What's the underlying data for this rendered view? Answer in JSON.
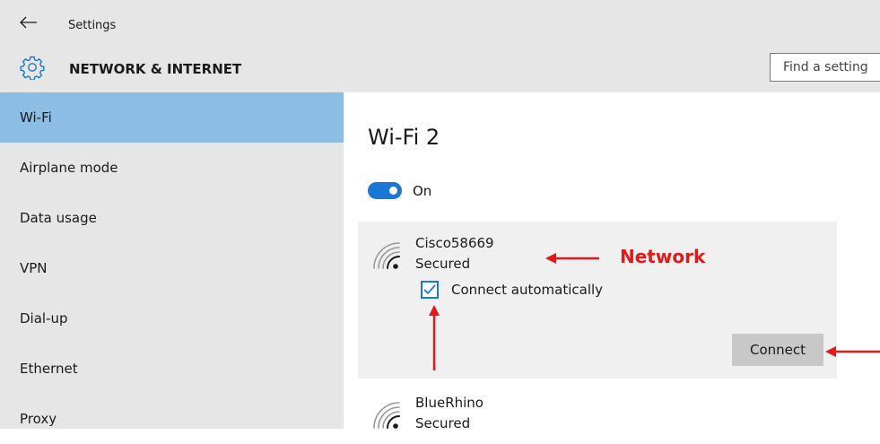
{
  "window": {
    "app_title": "Settings"
  },
  "header": {
    "section_title": "NETWORK & INTERNET",
    "search_placeholder": "Find a setting"
  },
  "sidebar": {
    "items": [
      {
        "label": "Wi-Fi",
        "active": true
      },
      {
        "label": "Airplane mode",
        "active": false
      },
      {
        "label": "Data usage",
        "active": false
      },
      {
        "label": "VPN",
        "active": false
      },
      {
        "label": "Dial-up",
        "active": false
      },
      {
        "label": "Ethernet",
        "active": false
      },
      {
        "label": "Proxy",
        "active": false
      }
    ]
  },
  "main": {
    "title": "Wi-Fi 2",
    "toggle": {
      "label": "On",
      "state": true
    },
    "networks": [
      {
        "name": "Cisco58669",
        "status": "Secured",
        "connect_automatically": {
          "label": "Connect automatically",
          "checked": true
        },
        "connect_button": "Connect"
      },
      {
        "name": "BlueRhino",
        "status": "Secured"
      }
    ]
  },
  "annotation": {
    "label": "Network",
    "color": "#e41818"
  },
  "colors": {
    "accent": "#1a78d4",
    "sidebar_active": "#8cbde4",
    "chrome": "#e6e6e6"
  },
  "icons": [
    "back-arrow-icon",
    "gear-icon",
    "wifi-icon",
    "checkmark-icon"
  ]
}
